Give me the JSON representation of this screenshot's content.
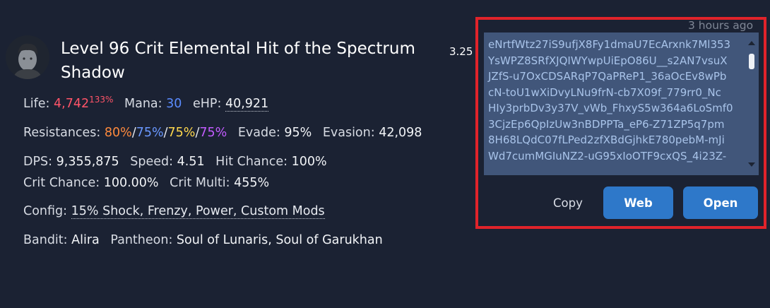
{
  "character": {
    "avatar_icon": "character-portrait-icon",
    "title": "Level 96 Crit Elemental Hit of the Spectrum Shadow",
    "number": "3.25"
  },
  "stats": {
    "life_label": "Life:",
    "life_value": "4,742",
    "life_pct": "133%",
    "mana_label": "Mana:",
    "mana_value": "30",
    "ehp_label": "eHP:",
    "ehp_value": "40,921",
    "resist_label": "Resistances:",
    "res_fire": "80%",
    "res_cold": "75%",
    "res_light": "75%",
    "res_chaos": "75%",
    "slash": "/",
    "evade_label": "Evade:",
    "evade_value": "95%",
    "evasion_label": "Evasion:",
    "evasion_value": "42,098",
    "dps_label": "DPS:",
    "dps_value": "9,355,875",
    "speed_label": "Speed:",
    "speed_value": "4.51",
    "hit_label": "Hit Chance:",
    "hit_value": "100%",
    "crit_label": "Crit Chance:",
    "crit_value": "100.00%",
    "multi_label": "Crit Multi:",
    "multi_value": "455%",
    "config_label": "Config:",
    "config_value": "15% Shock, Frenzy, Power, Custom Mods",
    "bandit_label": "Bandit:",
    "bandit_value": "Alira",
    "pantheon_label": "Pantheon:",
    "pantheon_value": "Soul of Lunaris, Soul of Garukhan"
  },
  "share": {
    "timestamp": "3 hours ago",
    "code_lines": [
      "eNrtfWtz27iS9ufjX8Fy1dmaU7EcArxnk7Ml353",
      "YsWPZ8SRfXJQIWYwpUiEpO86U__s2AN7vsuX",
      "JZfS-u7OxCDSARqP7QaPReP1_36aOcEv8wPb",
      "cN-toU1wXiDvyLNu9frN-cb7X09f_779rr0_Nc",
      "HIy3prbDv3y37V_vWb_FhxyS5w364a6LoSmf0",
      "3CjzEp6QpIzUw3nBDPPTa_eP6-Z71ZP5q7pm",
      "8H68LQdC07fLPed2zfXBdGjhkE780pebM-mJi",
      "Wd7cumMGIuNZ2-uG95xIoOTF9cxQS_4i23Z-"
    ],
    "copy_label": "Copy",
    "web_label": "Web",
    "open_label": "Open"
  },
  "colors": {
    "background": "#1b2233",
    "life": "#ff5468",
    "mana": "#5b8cff",
    "res_fire": "#ff8a3d",
    "res_cold": "#6a98ff",
    "res_light": "#ffd84d",
    "res_chaos": "#c25cff",
    "button": "#2e78c9",
    "highlight_border": "#e0232a"
  }
}
